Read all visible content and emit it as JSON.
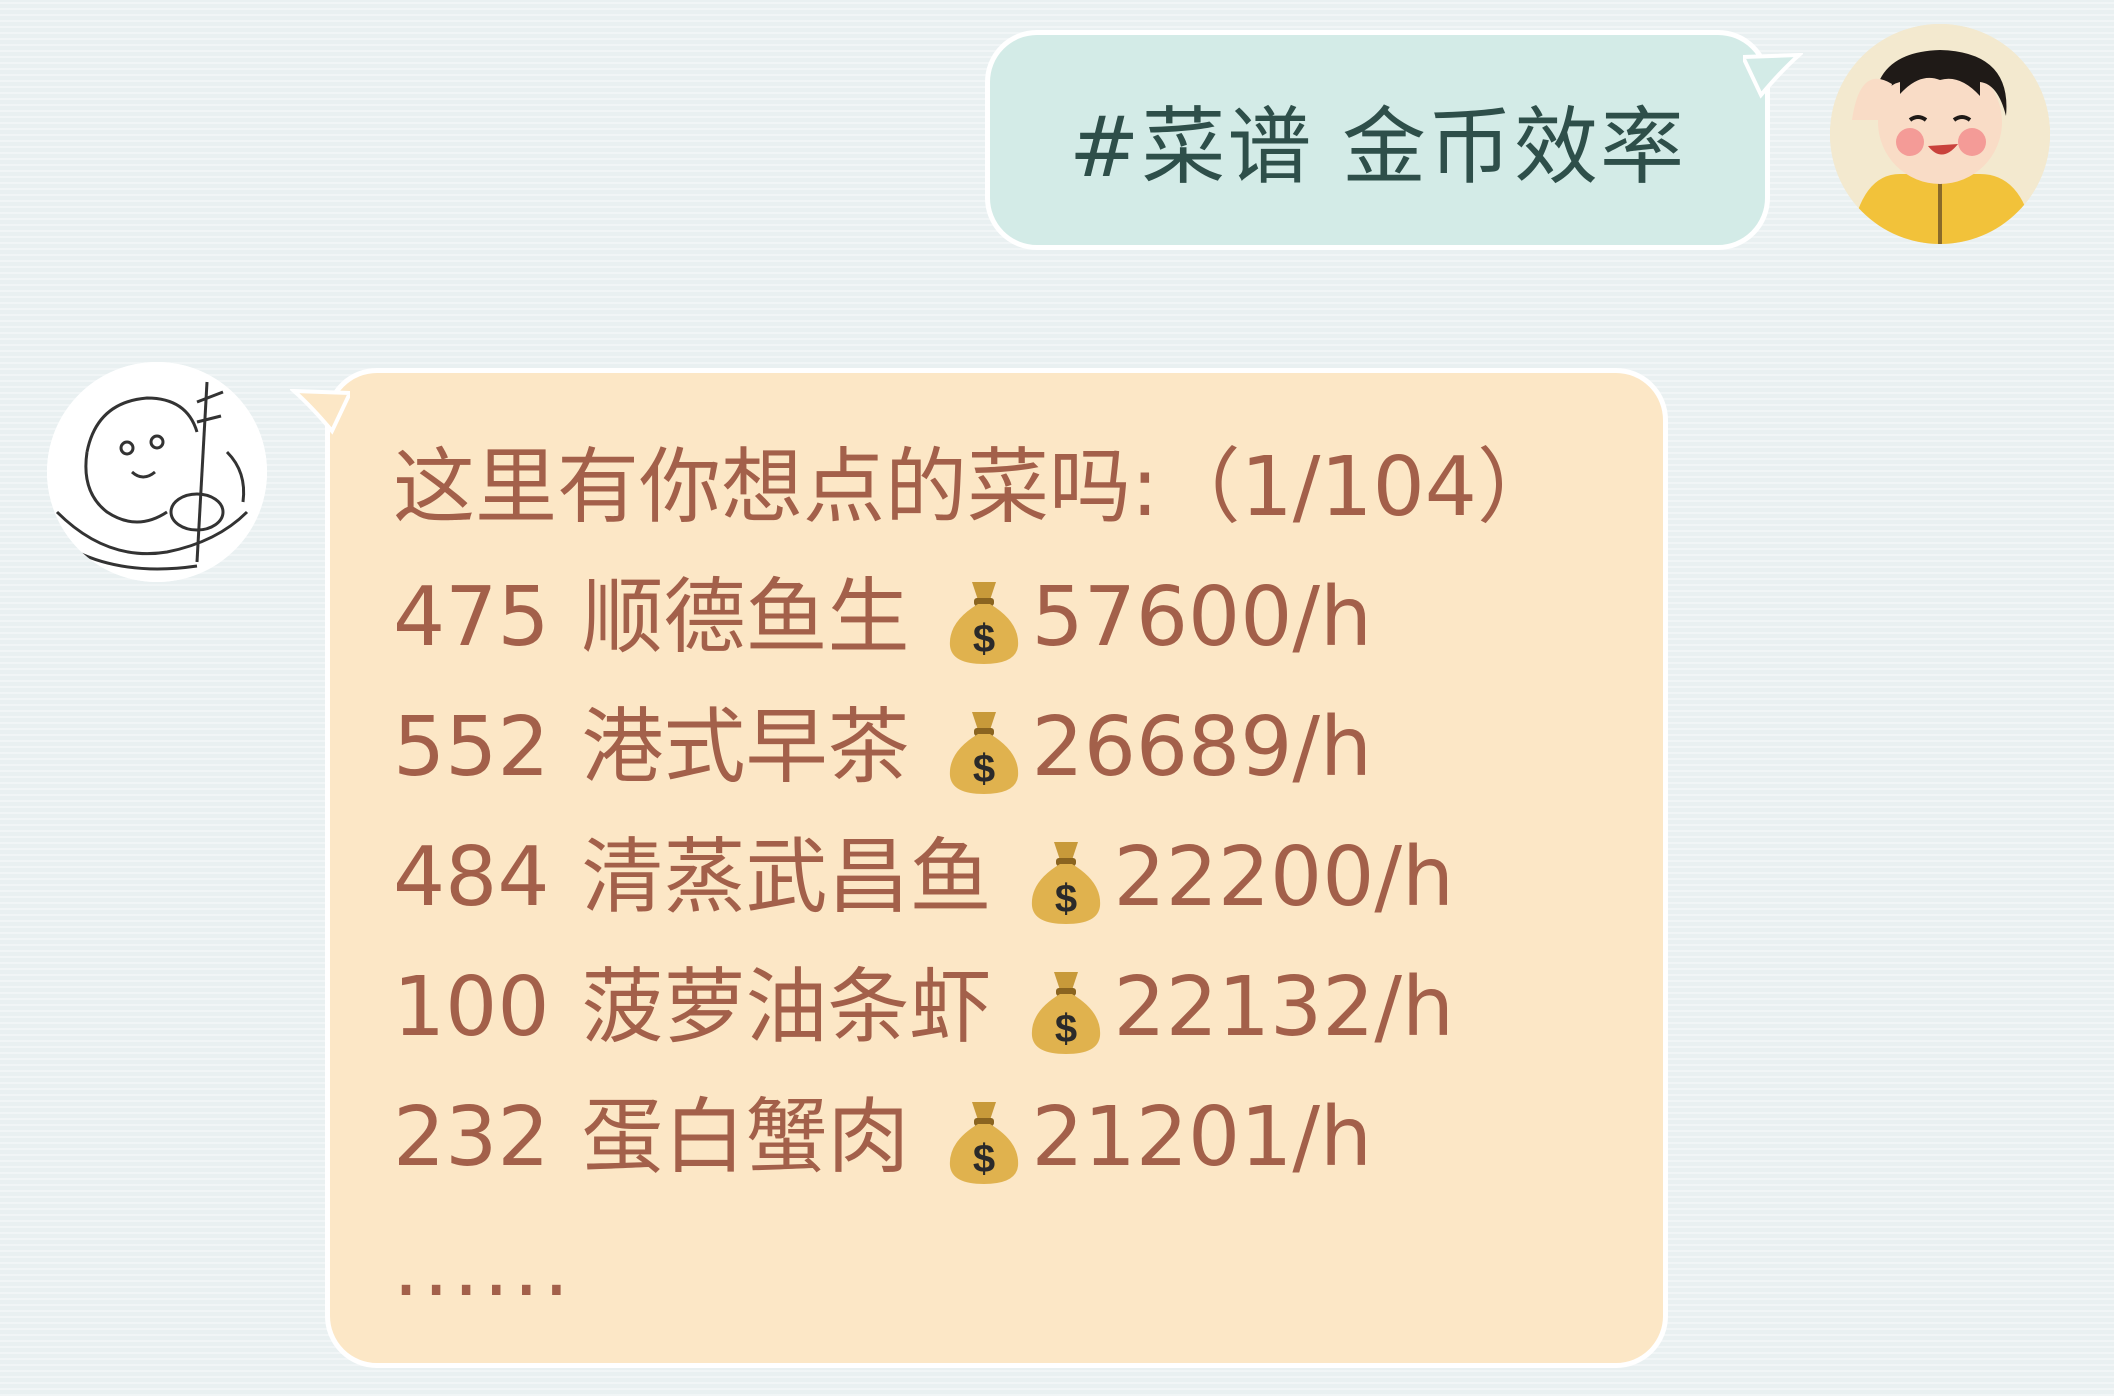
{
  "user_message": {
    "text": "#菜谱 金币效率",
    "avatar": "cartoon-girl-avatar"
  },
  "bot_message": {
    "avatar": "sketch-character-avatar",
    "header": "这里有你想点的菜吗:（1/104）",
    "items": [
      {
        "id": "475",
        "name": "顺德鱼生",
        "icon": "money-bag-icon",
        "rate": "57600/h"
      },
      {
        "id": "552",
        "name": "港式早茶",
        "icon": "money-bag-icon",
        "rate": "26689/h"
      },
      {
        "id": "484",
        "name": "清蒸武昌鱼",
        "icon": "money-bag-icon",
        "rate": "22200/h"
      },
      {
        "id": "100",
        "name": "菠萝油条虾",
        "icon": "money-bag-icon",
        "rate": "22132/h"
      },
      {
        "id": "232",
        "name": "蛋白蟹肉",
        "icon": "money-bag-icon",
        "rate": "21201/h"
      }
    ],
    "footer": "......"
  },
  "colors": {
    "background": "#e9f0f1",
    "user_bubble": "#d3ebe7",
    "user_text": "#2e4f4a",
    "bot_bubble": "#fce7c6",
    "bot_text": "#a3604a"
  }
}
